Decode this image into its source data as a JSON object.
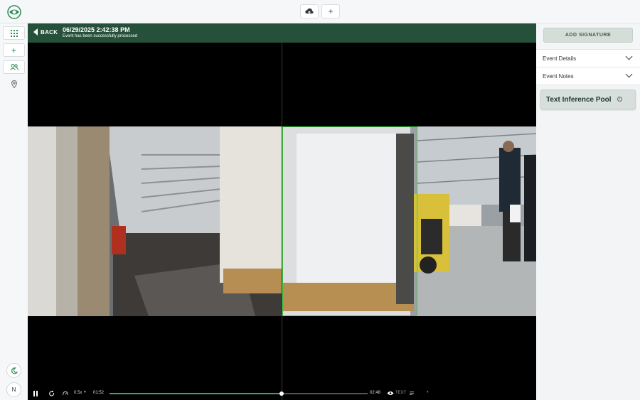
{
  "topbar": {
    "logo_icon": "eye-logo",
    "upload_icon": "cloud-upload-icon",
    "add_icon": "plus-icon",
    "add_label": "+"
  },
  "leftbar": {
    "grid_icon": "grid-icon",
    "add_label": "+",
    "users_icon": "users-icon",
    "location_icon": "location-pin-icon",
    "theme_icon": "moon-icon",
    "avatar_initial": "N"
  },
  "header": {
    "back_label": "BACK",
    "title": "06/29/2025 2:42:38 PM",
    "subtitle": "Event has been successfully processed"
  },
  "player": {
    "speed": "0.5x",
    "current_time": "01:52",
    "end_time": "02:48",
    "text_toggle": "TEXT",
    "progress": 0.667,
    "icons": [
      "pause-icon",
      "replay-icon",
      "speed-icon",
      "eye-icon",
      "caption-icon",
      "chevron-down-icon"
    ]
  },
  "sidebar": {
    "add_signature": "ADD SIGNATURE",
    "sections": [
      {
        "label": "Event Details"
      },
      {
        "label": "Event Notes"
      }
    ],
    "pool_title": "Text Inference Pool",
    "pool_info": "i"
  },
  "colors": {
    "brand_green": "#25503a",
    "accent": "#3aa660",
    "bbox": "#3ecf3e"
  }
}
